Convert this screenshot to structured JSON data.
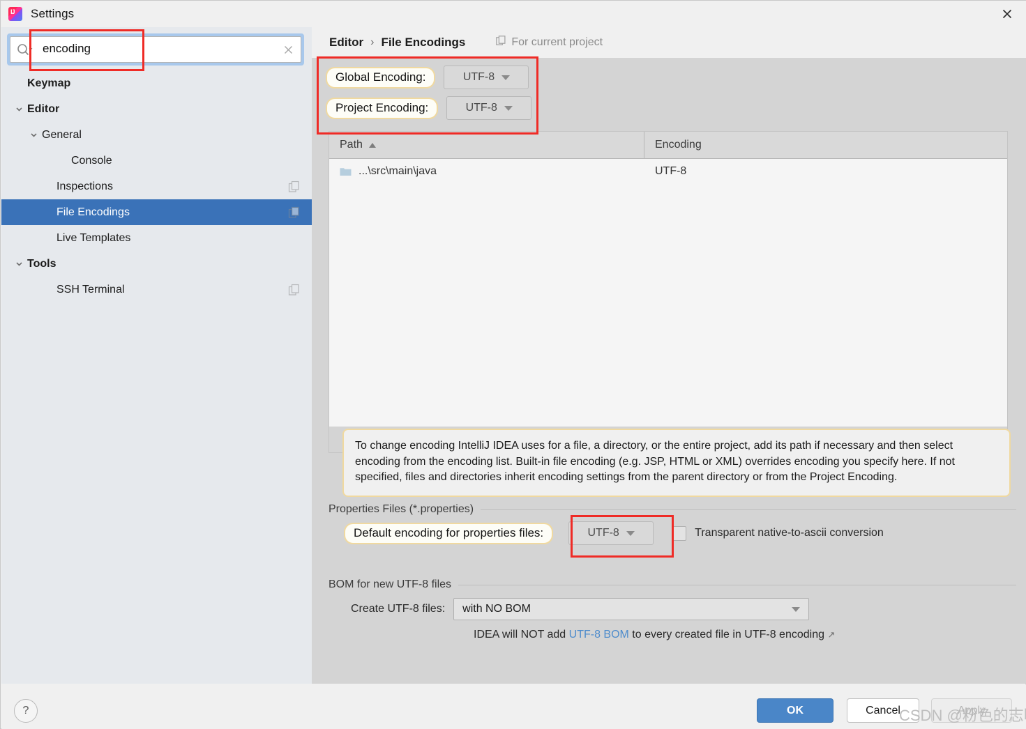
{
  "window": {
    "title": "Settings",
    "app_icon": "intellij-idea-icon",
    "close_icon": "close-icon"
  },
  "search": {
    "value": "encoding",
    "placeholder": "",
    "search_icon": "search-icon",
    "clear_icon": "clear-icon"
  },
  "sidebar": {
    "items": [
      {
        "label": "Keymap",
        "indent": 0,
        "bold": true,
        "chevron": "",
        "badge": false
      },
      {
        "label": "Editor",
        "indent": 0,
        "bold": true,
        "chevron": "down",
        "badge": false
      },
      {
        "label": "General",
        "indent": 1,
        "bold": false,
        "chevron": "down",
        "badge": false
      },
      {
        "label": "Console",
        "indent": 3,
        "bold": false,
        "chevron": "",
        "badge": false
      },
      {
        "label": "Inspections",
        "indent": 2,
        "bold": false,
        "chevron": "",
        "badge": true
      },
      {
        "label": "File Encodings",
        "indent": 2,
        "bold": false,
        "chevron": "",
        "badge": true,
        "selected": true
      },
      {
        "label": "Live Templates",
        "indent": 2,
        "bold": false,
        "chevron": "",
        "badge": false
      },
      {
        "label": "Tools",
        "indent": 0,
        "bold": true,
        "chevron": "down",
        "badge": false
      },
      {
        "label": "SSH Terminal",
        "indent": 2,
        "bold": false,
        "chevron": "",
        "badge": true
      }
    ]
  },
  "breadcrumb": {
    "parent": "Editor",
    "separator": "›",
    "current": "File Encodings",
    "note": "For current project",
    "note_icon": "copy-icon"
  },
  "encodings": {
    "global": {
      "label": "Global Encoding:",
      "value": "UTF-8"
    },
    "project": {
      "label": "Project Encoding:",
      "value": "UTF-8"
    }
  },
  "table": {
    "columns": [
      "Path",
      "Encoding"
    ],
    "sort_column": "Path",
    "sort_direction": "asc",
    "rows": [
      {
        "path": "...\\src\\main\\java",
        "encoding": "UTF-8",
        "icon": "folder-icon"
      }
    ],
    "toolbar": [
      {
        "name": "add-button",
        "icon": "plus-icon",
        "enabled": true
      },
      {
        "name": "remove-button",
        "icon": "minus-icon",
        "enabled": false
      },
      {
        "name": "edit-button",
        "icon": "pencil-icon",
        "enabled": false
      }
    ]
  },
  "info_text": "To change encoding IntelliJ IDEA uses for a file, a directory, or the entire project, add its path if necessary and then select encoding from the encoding list. Built-in file encoding (e.g. JSP, HTML or XML) overrides encoding you specify here. If not specified, files and directories inherit encoding settings from the parent directory or from the Project Encoding.",
  "properties_section": {
    "title": "Properties Files (*.properties)",
    "default_encoding_label": "Default encoding for properties files:",
    "default_encoding_value": "UTF-8",
    "transparent_label": "Transparent native-to-ascii conversion",
    "transparent_checked": false
  },
  "bom_section": {
    "title": "BOM for new UTF-8 files",
    "create_label": "Create UTF-8 files:",
    "create_value": "with NO BOM",
    "hint_prefix": "IDEA will NOT add ",
    "hint_link": "UTF-8 BOM",
    "hint_suffix": " to every created file in UTF-8 encoding",
    "hint_ext_icon": "↗"
  },
  "footer": {
    "help_label": "?",
    "ok_label": "OK",
    "cancel_label": "Cancel",
    "apply_label": "Apply",
    "apply_enabled": false
  },
  "watermark": "CSDN @粉色的志明",
  "colors": {
    "selection_blue": "#3a72b8",
    "primary_button": "#4a86c8",
    "annotation_red": "#ef2b26",
    "highlight_border": "#f0d9a0",
    "link_blue": "#4e8ccc"
  }
}
